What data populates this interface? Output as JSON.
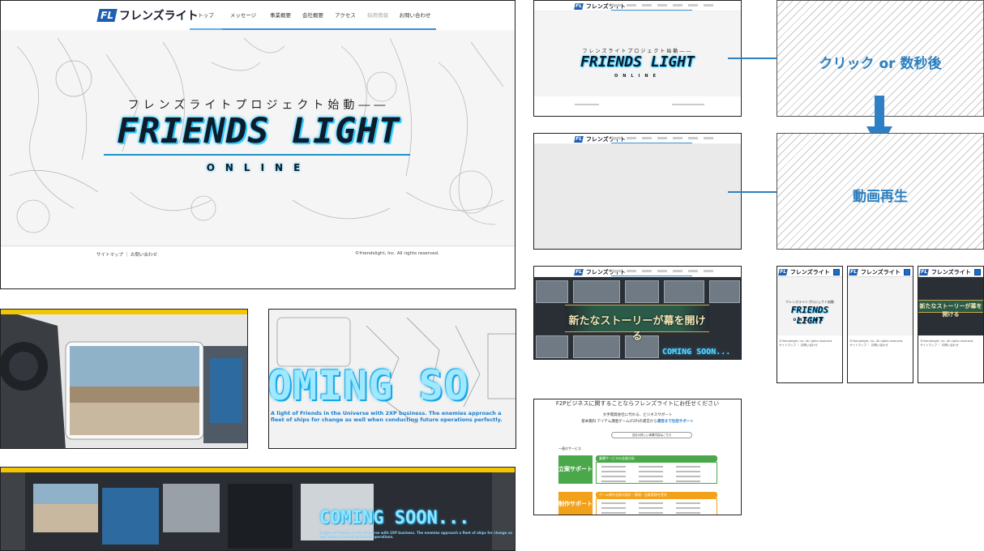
{
  "brand": {
    "logo_mark": "FL",
    "name": "フレンズライト"
  },
  "main": {
    "nav": [
      "トップ",
      "メッセージ",
      "事業概要",
      "会社概要",
      "アクセス",
      "採用情報",
      "お問い合わせ"
    ],
    "tagline": "フレンズライトプロジェクト始動――",
    "title": "FRIENDS LIGHT",
    "subtitle": "ONLINE",
    "footer_links": "サイトマップ ｜ お問い合わせ",
    "copyright": "©friendslight, Inc. All rights reserved."
  },
  "flow": {
    "step1_label": "クリック or 数秒後",
    "step2_label": "動画再生"
  },
  "s1": {
    "tagline": "フレンズライトプロジェクト始動――",
    "title": "FRIENDS LIGHT",
    "subtitle": "ONLINE"
  },
  "s3": {
    "banner": "新たなストーリーが幕を開ける",
    "coming": "COMING SOON..."
  },
  "s4": {
    "heading": "F2Pビジネスに関することならフレンズライトにお任せください",
    "line1": "大手開発会社に代わる、ビジネスサポート",
    "line2": "基本無料 アイテム課金ゲーム(F2P)の運営から",
    "line2_emph": "運営まで包括サポート",
    "button": "当社の詳しい事業内容はこちら",
    "section": "一連のサービス",
    "green_left": "立案サポート",
    "green_head": "業種サービスの全般分析",
    "orange_left": "制作サポート",
    "orange_head": "ゲーム制作全般の設計・管理・品質管理を受託"
  },
  "phones": {
    "p1_sub": "フレンズライトプロジェクト始動",
    "p1_title": "FRIENDS LIGHT",
    "p1_online": "ONLINE",
    "footer": "©friendslight, Inc. All rights reserved.",
    "footer_links": "サイトマップ ｜ お問い合わせ",
    "p3_banner": "新たなストーリーが幕を開ける"
  },
  "game": {
    "coming_big": "OMING SO",
    "coming_fine": "A light of Friends in the Universe with 2XP business. The enemies approach a fleet of ships for change as well when conducting future operations perfectly.",
    "coming_mid": "COMING SOON...",
    "coming_mid_fine": "A light of Friends in the Universe with 2XP business. The enemies approach a fleet of ships for change as well when conducting future operations."
  },
  "colors": {
    "accent": "#2a7fc0",
    "cyan_glow": "#2ec9ff",
    "green": "#4aa84a",
    "orange": "#f2a11a",
    "logo_blue": "#1e5fb3"
  }
}
